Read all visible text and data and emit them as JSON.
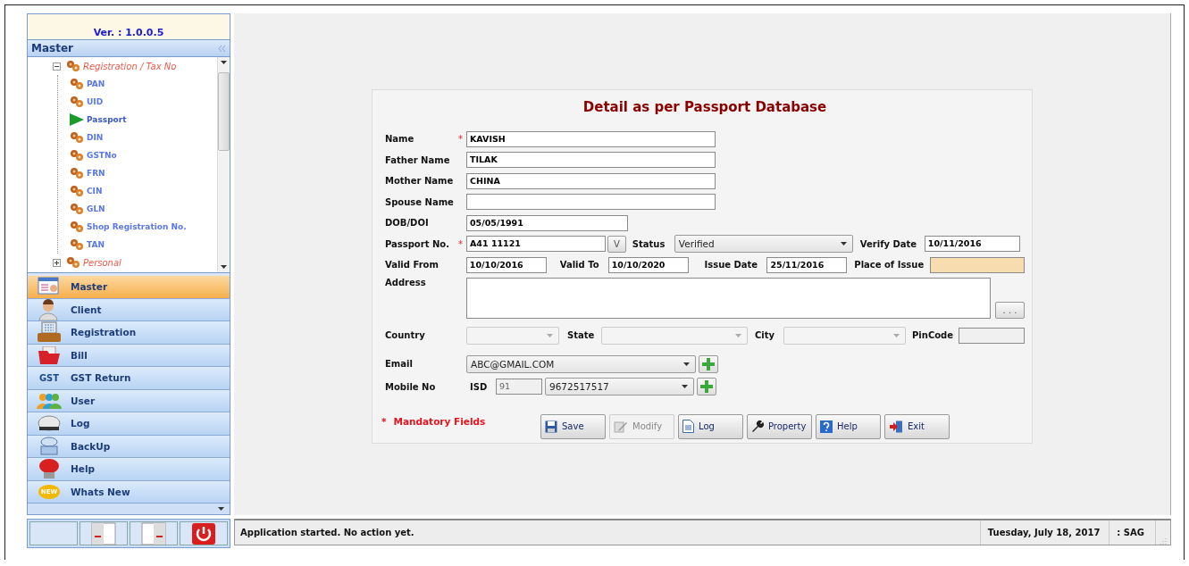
{
  "sidebar": {
    "version": "Ver. : 1.0.0.5",
    "header": "Master",
    "tree": [
      {
        "label": "Registration / Tax No",
        "expanded": true,
        "selected": false,
        "children": [
          {
            "label": "PAN",
            "selected": false
          },
          {
            "label": "UID",
            "selected": false
          },
          {
            "label": "Passport",
            "selected": true
          },
          {
            "label": "DIN",
            "selected": false
          },
          {
            "label": "GSTNo",
            "selected": false
          },
          {
            "label": "FRN",
            "selected": false
          },
          {
            "label": "CIN",
            "selected": false
          },
          {
            "label": "GLN",
            "selected": false
          },
          {
            "label": "Shop Registration No.",
            "selected": false
          },
          {
            "label": "TAN",
            "selected": false
          }
        ]
      },
      {
        "label": "Personal",
        "expanded": false,
        "selected": false
      }
    ],
    "nav": [
      {
        "label": "Master",
        "selected": true
      },
      {
        "label": "Client",
        "selected": false
      },
      {
        "label": "Registration",
        "selected": false
      },
      {
        "label": "Bill",
        "selected": false
      },
      {
        "label": "GST Return",
        "icon_text": "GST",
        "selected": false
      },
      {
        "label": "User",
        "selected": false
      },
      {
        "label": "Log",
        "selected": false
      },
      {
        "label": "BackUp",
        "selected": false
      },
      {
        "label": "Help",
        "selected": false
      },
      {
        "label": "Whats New",
        "icon_text": "NEW",
        "selected": false
      }
    ]
  },
  "form": {
    "title": "Detail as per Passport Database",
    "name": {
      "label": "Name",
      "required": true,
      "value": "KAVISH"
    },
    "father_name": {
      "label": "Father Name",
      "required": false,
      "value": "TILAK"
    },
    "mother_name": {
      "label": "Mother Name",
      "required": false,
      "value": "CHINA"
    },
    "spouse_name": {
      "label": "Spouse Name",
      "required": false
    },
    "dob": {
      "label": "DOB/DOI",
      "required": false,
      "value": "05/05/1991"
    },
    "passport_no": {
      "label": "Passport No.",
      "required": true,
      "value": "A41 11121",
      "verify_button": "V"
    },
    "status": {
      "label": "Status",
      "value": "Verified"
    },
    "verify_date": {
      "label": "Verify Date",
      "value": "10/11/2016"
    },
    "valid_from": {
      "label": "Valid From",
      "value": "10/10/2016"
    },
    "valid_to": {
      "label": "Valid To",
      "value": "10/10/2020"
    },
    "issue_date": {
      "label": "Issue Date",
      "value": "25/11/2016"
    },
    "place_of_issue": {
      "label": "Place of Issue"
    },
    "address": {
      "label": "Address",
      "browse_button": ". . ."
    },
    "country": {
      "label": "Country",
      "disabled": true
    },
    "state": {
      "label": "State",
      "disabled": true
    },
    "city": {
      "label": "City",
      "disabled": true
    },
    "pincode": {
      "label": "PinCode"
    },
    "email": {
      "label": "Email",
      "value": "ABC@GMAIL.COM"
    },
    "mobile": {
      "label": "Mobile No",
      "isd_label": "ISD",
      "isd_value": "91",
      "value": "9672517517"
    },
    "mandatory_note": {
      "mark": "*",
      "text": "Mandatory Fields"
    },
    "buttons": [
      {
        "label": "Save",
        "disabled": false
      },
      {
        "label": "Modify",
        "disabled": true
      },
      {
        "label": "Log",
        "disabled": false
      },
      {
        "label": "Property",
        "disabled": false
      },
      {
        "label": "Help",
        "disabled": false
      },
      {
        "label": "Exit",
        "disabled": false
      }
    ]
  },
  "status_bar": {
    "message": "Application started. No action yet.",
    "date": "Tuesday, July 18, 2017",
    "user": ": SAG"
  }
}
